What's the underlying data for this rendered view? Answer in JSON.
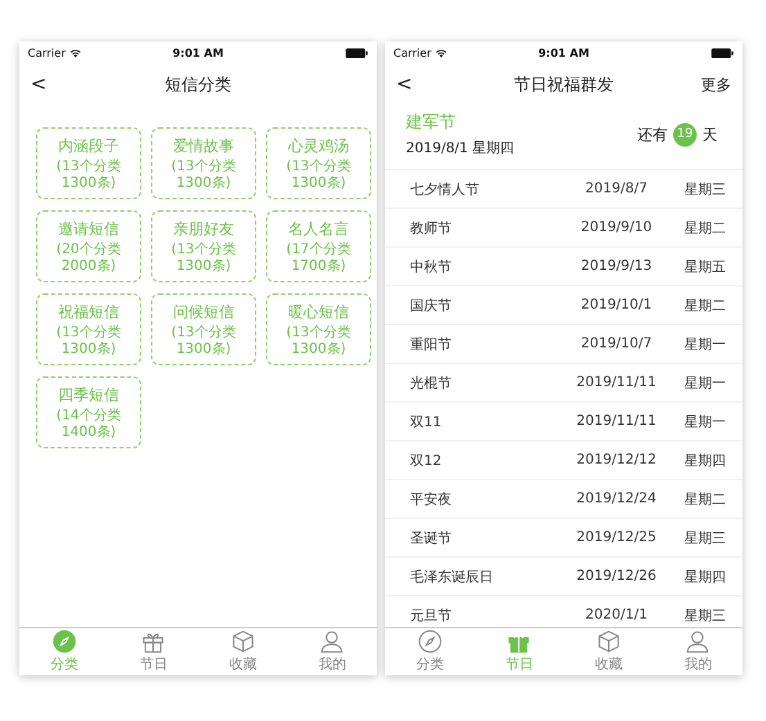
{
  "category_screen": {
    "status_bar": {
      "carrier": "Carrier",
      "time": "9:01 AM"
    },
    "nav": {
      "back": "<",
      "title": "短信分类"
    },
    "categories": [
      {
        "name": "内涵段子",
        "count": "(13个分类1300条)"
      },
      {
        "name": "爱情故事",
        "count": "(13个分类1300条)"
      },
      {
        "name": "心灵鸡汤",
        "count": "(13个分类1300条)"
      },
      {
        "name": "邀请短信",
        "count": "(20个分类2000条)"
      },
      {
        "name": "亲朋好友",
        "count": "(13个分类1300条)"
      },
      {
        "name": "名人名言",
        "count": "(17个分类1700条)"
      },
      {
        "name": "祝福短信",
        "count": "(13个分类1300条)"
      },
      {
        "name": "问候短信",
        "count": "(13个分类1300条)"
      },
      {
        "name": "暖心短信",
        "count": "(13个分类1300条)"
      },
      {
        "name": "四季短信",
        "count": "(14个分类1400条)"
      }
    ],
    "tab_bar": [
      {
        "label": "分类",
        "selected": true
      },
      {
        "label": "节日",
        "selected": false
      },
      {
        "label": "收藏",
        "selected": false
      },
      {
        "label": "我的",
        "selected": false
      }
    ]
  },
  "holiday_screen": {
    "status_bar": {
      "carrier": "Carrier",
      "time": "9:01 AM"
    },
    "nav": {
      "back": "<",
      "title": "节日祝福群发",
      "action": "更多"
    },
    "featured": {
      "name": "建军节",
      "date": "2019/8/1 星期四",
      "prefix": "还有",
      "days": "19",
      "suffix": "天"
    },
    "holidays": [
      {
        "name": "七夕情人节",
        "date": "2019/8/7",
        "weekday": "星期三"
      },
      {
        "name": "教师节",
        "date": "2019/9/10",
        "weekday": "星期二"
      },
      {
        "name": "中秋节",
        "date": "2019/9/13",
        "weekday": "星期五"
      },
      {
        "name": "国庆节",
        "date": "2019/10/1",
        "weekday": "星期二"
      },
      {
        "name": "重阳节",
        "date": "2019/10/7",
        "weekday": "星期一"
      },
      {
        "name": "光棍节",
        "date": "2019/11/11",
        "weekday": "星期一"
      },
      {
        "name": "双11",
        "date": "2019/11/11",
        "weekday": "星期一"
      },
      {
        "name": "双12",
        "date": "2019/12/12",
        "weekday": "星期四"
      },
      {
        "name": "平安夜",
        "date": "2019/12/24",
        "weekday": "星期二"
      },
      {
        "name": "圣诞节",
        "date": "2019/12/25",
        "weekday": "星期三"
      },
      {
        "name": "毛泽东诞辰日",
        "date": "2019/12/26",
        "weekday": "星期四"
      },
      {
        "name": "元旦节",
        "date": "2020/1/1",
        "weekday": "星期三"
      }
    ],
    "tab_bar": [
      {
        "label": "分类",
        "selected": false
      },
      {
        "label": "节日",
        "selected": true
      },
      {
        "label": "收藏",
        "selected": false
      },
      {
        "label": "我的",
        "selected": false
      }
    ]
  }
}
